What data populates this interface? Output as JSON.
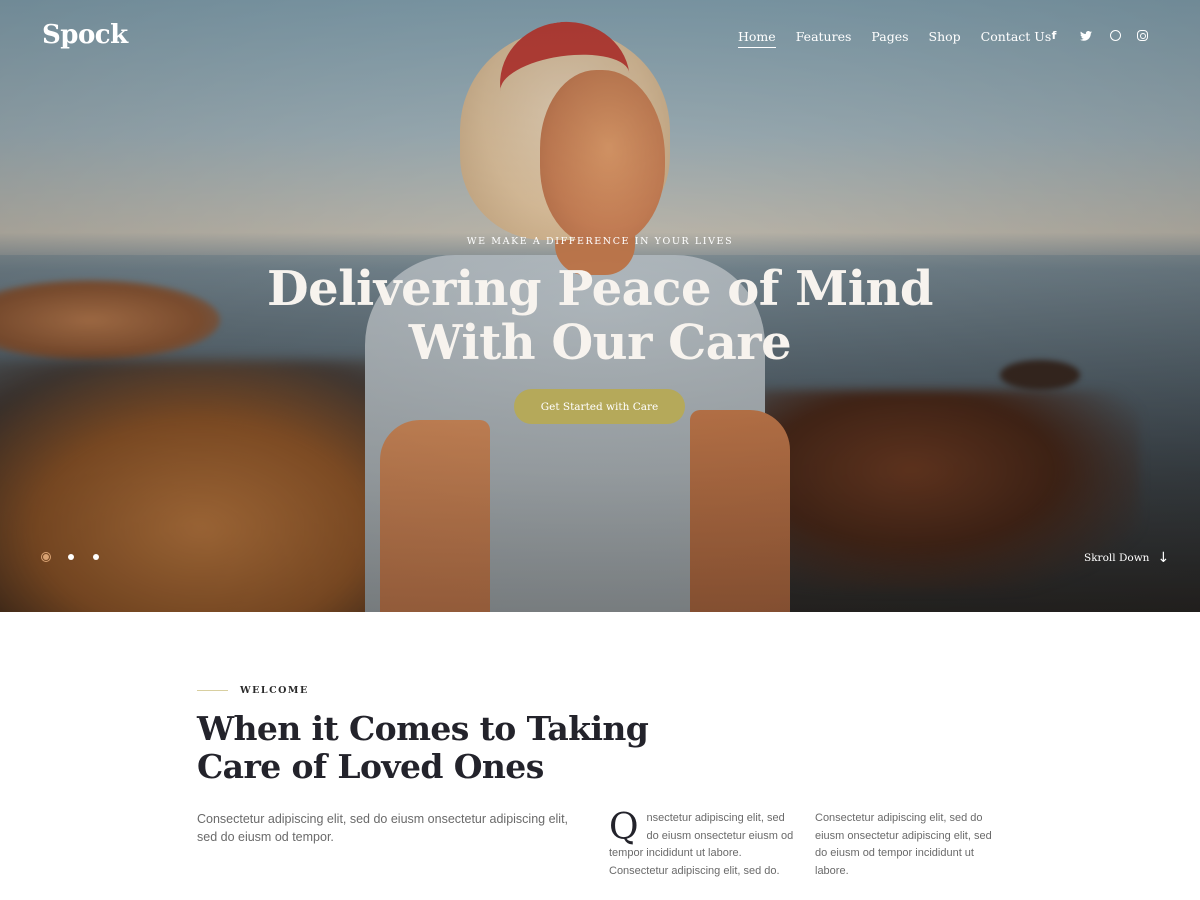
{
  "header": {
    "logo": "Spock",
    "nav": [
      {
        "label": "Home",
        "active": true
      },
      {
        "label": "Features"
      },
      {
        "label": "Pages"
      },
      {
        "label": "Shop"
      },
      {
        "label": "Contact Us"
      }
    ],
    "social": [
      "facebook-icon",
      "twitter-icon",
      "dribbble-icon",
      "instagram-icon"
    ],
    "social_glyphs": {
      "facebook": "f",
      "twitter": "🐦"
    }
  },
  "hero": {
    "eyebrow": "WE MAKE A DIFFERENCE IN YOUR LIVES",
    "title_line1": "Delivering Peace of Mind",
    "title_line2": "With Our Care",
    "cta_label": "Get Started with Care",
    "cta_color": "#b5a95a",
    "slides_count": 3,
    "active_slide": 1,
    "scroll_label": "Skroll Down",
    "scroll_glyph": "↓"
  },
  "welcome": {
    "label": "WELCOME",
    "title_line1": "When it Comes to Taking",
    "title_line2": "Care of Loved Ones",
    "intro": "Consectetur adipiscing elit, sed do eiusm onsectetur adipiscing elit, sed do eiusm od tempor.",
    "dropcap": "Q",
    "col1": "nsectetur adipiscing elit, sed do eiusm onsectetur eiusm od tempor incididunt ut labore. Consectetur adipiscing elit, sed do.",
    "col2": "Consectetur adipiscing elit, sed do eiusm onsectetur adipiscing elit, sed do eiusm od tempor incididunt ut labore."
  }
}
